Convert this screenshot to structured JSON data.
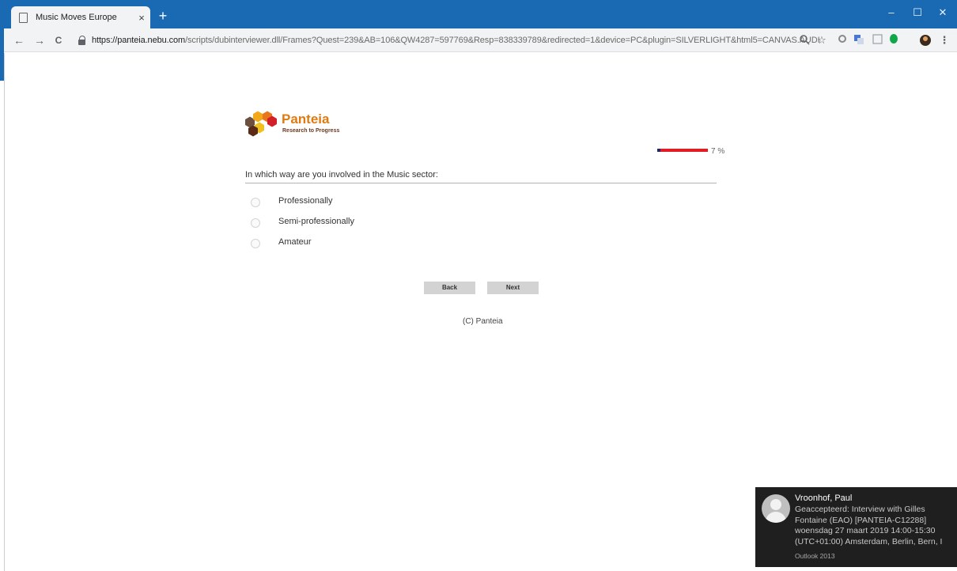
{
  "browser": {
    "tab_title": "Music Moves Europe",
    "tab_close": "×",
    "new_tab": "+",
    "window_controls": {
      "minimize": "–",
      "maximize": "☐",
      "close": "✕"
    },
    "nav": {
      "back": "←",
      "forward": "→",
      "reload": "C"
    },
    "url_host": "https://panteia.nebu.com",
    "url_path": "/scripts/dubinterviewer.dll/Frames?Quest=239&AB=106&QW4287=597769&Resp=838339789&redirected=1&device=PC&plugin=SILVERLIGHT&html5=CANVAS.AUDIO.A...",
    "toolbar_icons": [
      "zoom-icon",
      "star-icon",
      "extension-icon",
      "translate-icon",
      "pdf-icon",
      "leaf-icon",
      "profile-icon",
      "menu-icon"
    ]
  },
  "survey": {
    "brand_name": "Panteia",
    "tagline": "Research to Progress",
    "progress_percent": 7,
    "progress_label": "7 %",
    "question": "In which way are you involved in the Music sector:",
    "options": [
      {
        "label": "Professionally"
      },
      {
        "label": "Semi-professionally"
      },
      {
        "label": "Amateur"
      }
    ],
    "back_label": "Back",
    "next_label": "Next",
    "copyright": "(C) Panteia",
    "colors": {
      "brand_orange": "#e07a10",
      "progress_red": "#e31c23",
      "progress_blue": "#1d2a6b"
    }
  },
  "notification": {
    "sender": "Vroonhof, Paul",
    "message": "Geaccepteerd: Interview with Gilles Fontaine (EAO) [PANTEIA-C12288] woensdag 27 maart 2019 14:00-15:30 (UTC+01:00) Amsterdam, Berlin, Bern, I",
    "app": "Outlook 2013"
  }
}
